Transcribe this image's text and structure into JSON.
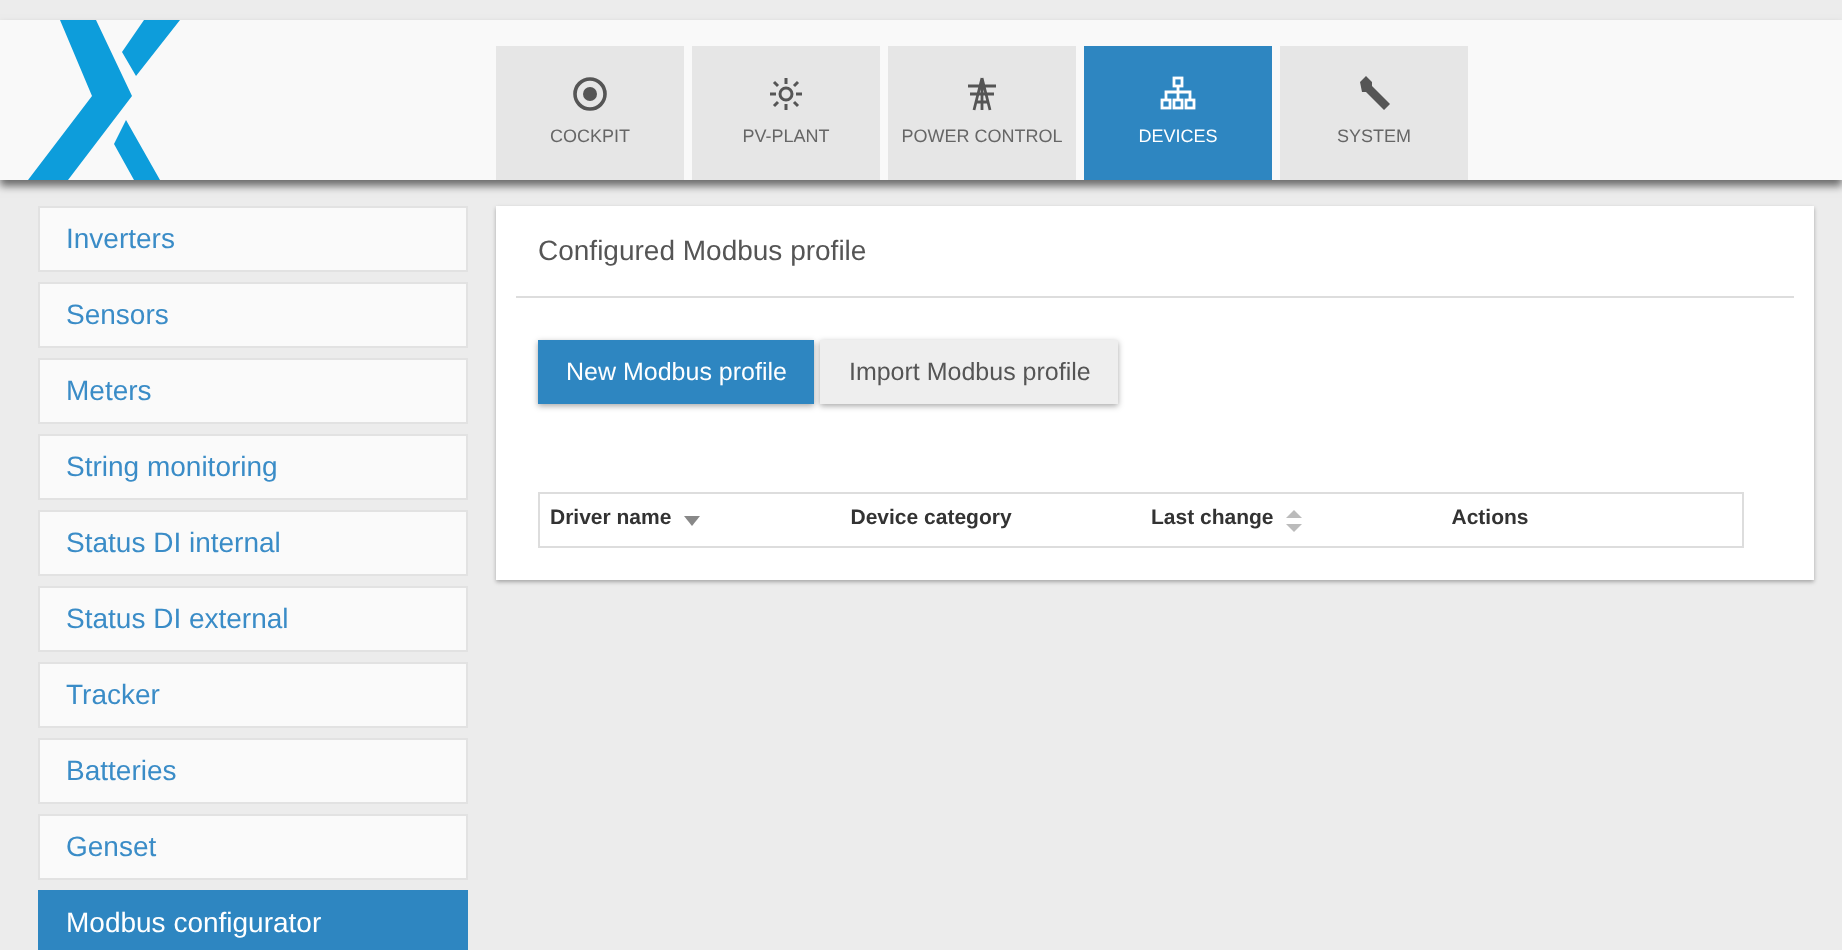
{
  "tabs": [
    {
      "label": "COCKPIT",
      "selected": false
    },
    {
      "label": "PV-PLANT",
      "selected": false
    },
    {
      "label": "POWER CONTROL",
      "selected": false
    },
    {
      "label": "DEVICES",
      "selected": true
    },
    {
      "label": "SYSTEM",
      "selected": false
    }
  ],
  "sidebar": {
    "items": [
      {
        "label": "Inverters",
        "selected": false
      },
      {
        "label": "Sensors",
        "selected": false
      },
      {
        "label": "Meters",
        "selected": false
      },
      {
        "label": "String monitoring",
        "selected": false
      },
      {
        "label": "Status DI internal",
        "selected": false
      },
      {
        "label": "Status DI external",
        "selected": false
      },
      {
        "label": "Tracker",
        "selected": false
      },
      {
        "label": "Batteries",
        "selected": false
      },
      {
        "label": "Genset",
        "selected": false
      },
      {
        "label": "Modbus configurator",
        "selected": true
      }
    ]
  },
  "panel": {
    "title": "Configured Modbus profile",
    "buttons": [
      {
        "label": "New Modbus profile",
        "kind": "primary"
      },
      {
        "label": "Import Modbus profile",
        "kind": "secondary"
      }
    ],
    "table": {
      "columns": [
        {
          "label": "Driver name",
          "kind": "sorted"
        },
        {
          "label": "Device category",
          "kind": "plain"
        },
        {
          "label": "Last change",
          "kind": "sortable"
        },
        {
          "label": "Actions",
          "kind": "plain"
        }
      ]
    }
  }
}
